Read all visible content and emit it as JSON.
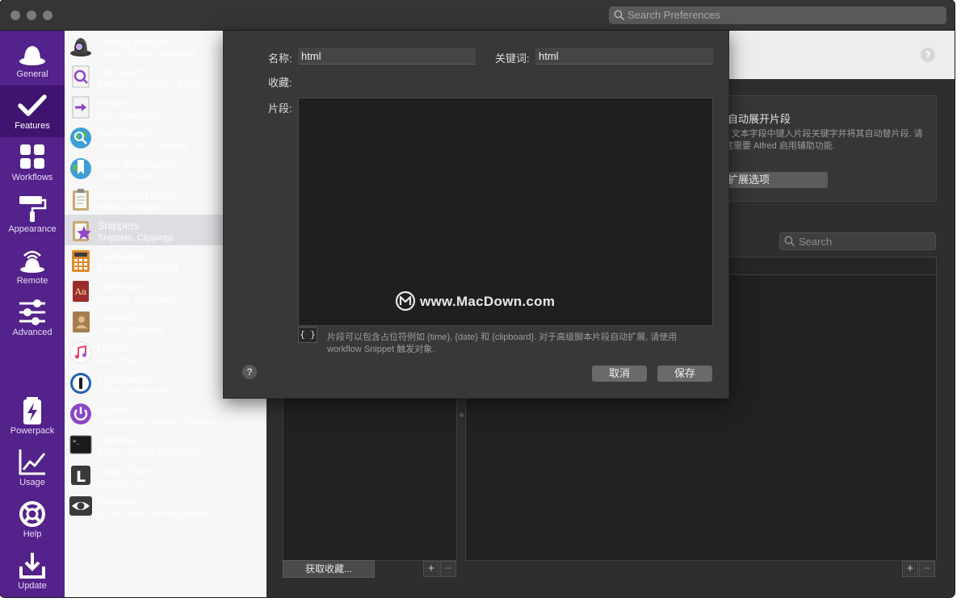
{
  "titlebar": {
    "search_placeholder": "Search Preferences"
  },
  "sidebar": {
    "items": [
      {
        "label": "General",
        "icon": "hat-icon"
      },
      {
        "label": "Features",
        "icon": "checkmark-icon"
      },
      {
        "label": "Workflows",
        "icon": "grid-icon"
      },
      {
        "label": "Appearance",
        "icon": "paint-roller-icon"
      },
      {
        "label": "Remote",
        "icon": "remote-icon"
      },
      {
        "label": "Advanced",
        "icon": "sliders-icon"
      },
      {
        "label": "Powerpack",
        "icon": "battery-icon"
      },
      {
        "label": "Usage",
        "icon": "chart-icon"
      },
      {
        "label": "Help",
        "icon": "lifebuoy-icon"
      },
      {
        "label": "Update",
        "icon": "download-icon"
      }
    ]
  },
  "features": [
    {
      "title": "Default Results",
      "sub": "Scope, Types, Fallbacks",
      "icon": "alfred-hat-icon"
    },
    {
      "title": "File Search",
      "sub": "Search, Navigation, Buffer",
      "icon": "file-search-icon"
    },
    {
      "title": "Actions",
      "sub": "Files, Navigation",
      "icon": "actions-arrow-icon"
    },
    {
      "title": "Web Search",
      "sub": "Custom, URLs, History",
      "icon": "globe-search-icon"
    },
    {
      "title": "Web Bookmarks",
      "sub": "Safari, Chrome",
      "icon": "globe-bookmark-icon"
    },
    {
      "title": "Clipboard History",
      "sub": "History, Merging",
      "icon": "clipboard-icon"
    },
    {
      "title": "Snippets",
      "sub": "Snippets, Clippings",
      "icon": "snippets-star-icon"
    },
    {
      "title": "Calculator",
      "sub": "Standard, Advanced",
      "icon": "calculator-icon"
    },
    {
      "title": "Dictionary",
      "sub": "Spelling, Definitions",
      "icon": "dictionary-icon"
    },
    {
      "title": "Contacts",
      "sub": "Viewer, Emailing",
      "icon": "contacts-icon"
    },
    {
      "title": "iTunes",
      "sub": "Mini Player",
      "icon": "itunes-note-icon"
    },
    {
      "title": "1Password",
      "sub": "1Click Bookmarks",
      "icon": "1password-icon"
    },
    {
      "title": "System",
      "sub": "Commands, Quitting, Ejecting",
      "icon": "power-icon"
    },
    {
      "title": "Terminal",
      "sub": "Prefix, Custom Integration",
      "icon": "terminal-icon"
    },
    {
      "title": "Large Type",
      "sub": "Display, Font",
      "icon": "large-type-icon"
    },
    {
      "title": "Previews",
      "sub": "Quick Look, Preview panels",
      "icon": "eye-icon"
    }
  ],
  "main": {
    "info_title": "键字自动展开片段",
    "info_text": "acOS 文本字段中键入片段关键字并将其自动替片段. 请注意这需要 Alfred 启用辅助功能.",
    "info_button": "自动扩展选项",
    "search_placeholder": "Search",
    "get_collections_button": "获取收藏...",
    "plus": "+",
    "minus": "−",
    "help": "?"
  },
  "sheet": {
    "name_label": "名称:",
    "name_value": "html",
    "keyword_label": "关键词:",
    "keyword_value": "html",
    "collection_label": "收藏:",
    "snippet_label": "片段:",
    "brace_button": "{ }",
    "hint": "片段可以包含占位符例如 {time}, {date} 和 {clipboard}. 对于高级脚本片段自动扩展, 请使用 workflow Snippet 触发对象.",
    "cancel": "取消",
    "save": "保存",
    "help": "?"
  },
  "watermark": {
    "text": "www.MacDown.com"
  },
  "colors": {
    "sidebar": "#53228a",
    "sidebar_active": "#3e1470",
    "sheet": "#383838"
  }
}
